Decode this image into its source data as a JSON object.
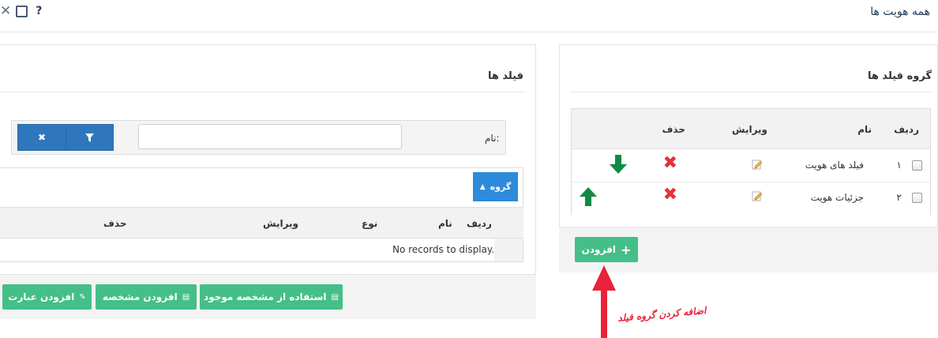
{
  "window": {
    "title": "همه هویت ها",
    "icons": [
      "close-icon",
      "maximize-icon",
      "help-icon"
    ],
    "help_glyph": "?"
  },
  "right_panel": {
    "title": "گروه فیلد ها",
    "columns": {
      "row": "ردیف",
      "name": "نام",
      "edit": "ویرایش",
      "delete": "حذف"
    },
    "rows": [
      {
        "index": "۱",
        "name": "فیلد های هویت",
        "move": "down"
      },
      {
        "index": "۲",
        "name": "جزئیات هویت",
        "move": "up"
      }
    ],
    "add_button": "افزودن"
  },
  "left_panel": {
    "title": "فیلد ها",
    "filter": {
      "name_label": "نام:",
      "name_value": ""
    },
    "group_button": "گروه",
    "columns": {
      "row": "ردیف",
      "name": "نام",
      "type": "نوع",
      "edit": "ویرایش",
      "delete": "حذف"
    },
    "empty_message": "No records to display.",
    "footer_buttons": [
      "استفاده از مشخصه موجود",
      "افزودن مشخصه",
      "افزودن عبارت"
    ]
  },
  "annotation": {
    "text": "اضافه کردن گروه فیلد",
    "color": "#e8233a"
  },
  "colors": {
    "green_button": "#44bf88",
    "blue_button": "#2e77bd",
    "group_button": "#2e8bdb",
    "delete_red": "#e4313e",
    "move_arrow_green": "#0f8a45"
  }
}
